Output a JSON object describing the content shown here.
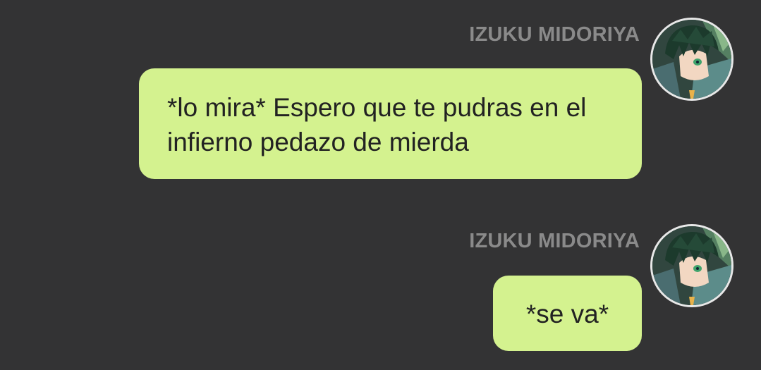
{
  "messages": [
    {
      "sender": "IZUKU MIDORIYA",
      "avatar_icon": "user-avatar-icon",
      "text": "*lo mira* Espero que te pudras en el infierno pedazo de mierda"
    },
    {
      "sender": "IZUKU MIDORIYA",
      "avatar_icon": "user-avatar-icon",
      "text": "*se va*"
    }
  ],
  "colors": {
    "background": "#333334",
    "bubble": "#d4f28f",
    "sender_name": "#8a8a8a",
    "message_text": "#222222"
  }
}
